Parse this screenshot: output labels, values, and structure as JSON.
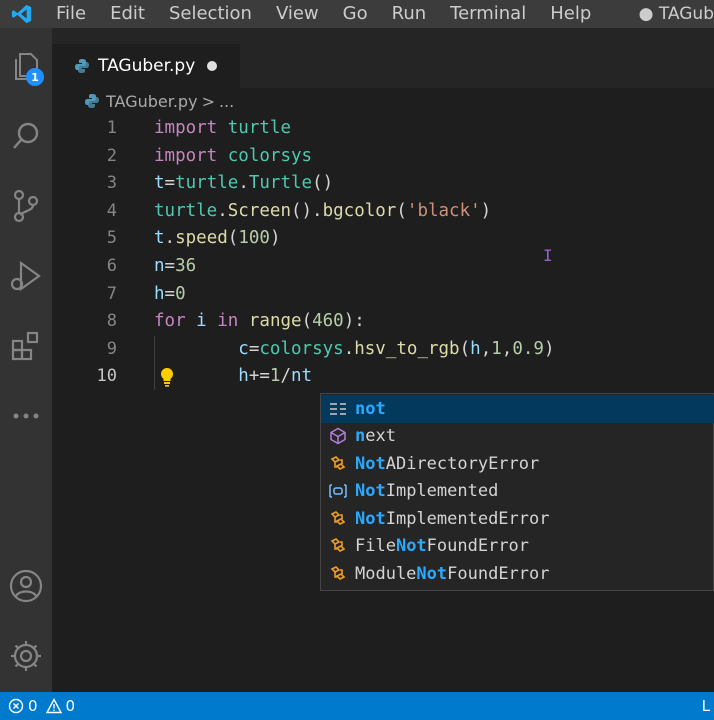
{
  "menubar": {
    "items": [
      "File",
      "Edit",
      "Selection",
      "View",
      "Go",
      "Run",
      "Terminal",
      "Help"
    ],
    "title": "● TAGub"
  },
  "activity": {
    "explorer_badge": "1",
    "icons": [
      "files-icon",
      "search-icon",
      "source-control-icon",
      "run-debug-icon",
      "extensions-icon",
      "more-icon",
      "account-icon",
      "settings-gear-icon"
    ]
  },
  "tab": {
    "label": "TAGuber.py",
    "modified": true
  },
  "breadcrumb": {
    "file": "TAGuber.py",
    "separator": ">",
    "more": "..."
  },
  "editor": {
    "lines": [
      {
        "n": "1",
        "tokens": [
          [
            "kw",
            "import"
          ],
          [
            "pl",
            " "
          ],
          [
            "id",
            "turtle"
          ]
        ]
      },
      {
        "n": "2",
        "tokens": [
          [
            "kw",
            "import"
          ],
          [
            "pl",
            " "
          ],
          [
            "id",
            "colorsys"
          ]
        ]
      },
      {
        "n": "3",
        "tokens": [
          [
            "var",
            "t"
          ],
          [
            "pl",
            "="
          ],
          [
            "id",
            "turtle"
          ],
          [
            "pl",
            "."
          ],
          [
            "id",
            "Turtle"
          ],
          [
            "pl",
            "()"
          ]
        ]
      },
      {
        "n": "4",
        "tokens": [
          [
            "id",
            "turtle"
          ],
          [
            "pl",
            "."
          ],
          [
            "fn",
            "Screen"
          ],
          [
            "pl",
            "()."
          ],
          [
            "fn",
            "bgcolor"
          ],
          [
            "pl",
            "("
          ],
          [
            "str",
            "'black'"
          ],
          [
            "pl",
            ")"
          ]
        ]
      },
      {
        "n": "5",
        "tokens": [
          [
            "var",
            "t"
          ],
          [
            "pl",
            "."
          ],
          [
            "fn",
            "speed"
          ],
          [
            "pl",
            "("
          ],
          [
            "num",
            "100"
          ],
          [
            "pl",
            ")"
          ]
        ]
      },
      {
        "n": "6",
        "tokens": [
          [
            "var",
            "n"
          ],
          [
            "pl",
            "="
          ],
          [
            "num",
            "36"
          ]
        ]
      },
      {
        "n": "7",
        "tokens": [
          [
            "var",
            "h"
          ],
          [
            "pl",
            "="
          ],
          [
            "num",
            "0"
          ]
        ]
      },
      {
        "n": "8",
        "tokens": [
          [
            "kw",
            "for"
          ],
          [
            "pl",
            " "
          ],
          [
            "var",
            "i"
          ],
          [
            "pl",
            " "
          ],
          [
            "kw",
            "in"
          ],
          [
            "pl",
            " "
          ],
          [
            "fn",
            "range"
          ],
          [
            "pl",
            "("
          ],
          [
            "num",
            "460"
          ],
          [
            "pl",
            "):"
          ]
        ]
      },
      {
        "n": "9",
        "tokens": [
          [
            "pl",
            "        "
          ],
          [
            "var",
            "c"
          ],
          [
            "pl",
            "="
          ],
          [
            "id",
            "colorsys"
          ],
          [
            "pl",
            "."
          ],
          [
            "fn",
            "hsv_to_rgb"
          ],
          [
            "pl",
            "("
          ],
          [
            "var",
            "h"
          ],
          [
            "pl",
            ","
          ],
          [
            "num",
            "1"
          ],
          [
            "pl",
            ","
          ],
          [
            "num",
            "0.9"
          ],
          [
            "pl",
            ")"
          ]
        ]
      },
      {
        "n": "10",
        "tokens": [
          [
            "pl",
            "        "
          ],
          [
            "var",
            "h"
          ],
          [
            "pl",
            "+="
          ],
          [
            "num",
            "1"
          ],
          [
            "pl",
            "/"
          ],
          [
            "var",
            "nt"
          ]
        ]
      }
    ]
  },
  "suggestions": [
    {
      "label": "not",
      "match": [
        0,
        3
      ],
      "kind": "keyword",
      "selected": true
    },
    {
      "label": "next",
      "match": [
        0,
        1
      ],
      "kind": "function"
    },
    {
      "label": "NotADirectoryError",
      "match": [
        0,
        3
      ],
      "kind": "class"
    },
    {
      "label": "NotImplemented",
      "match": [
        0,
        3
      ],
      "kind": "variable"
    },
    {
      "label": "NotImplementedError",
      "match": [
        0,
        3
      ],
      "kind": "class"
    },
    {
      "label": "FileNotFoundError",
      "match": [
        4,
        7
      ],
      "kind": "class"
    },
    {
      "label": "ModuleNotFoundError",
      "match": [
        6,
        9
      ],
      "kind": "class"
    }
  ],
  "statusbar": {
    "errors": "0",
    "warnings": "0",
    "right": "L"
  },
  "colors": {
    "accent": "#007acc",
    "badge": "#1e90ff",
    "match": "#2aaaff"
  }
}
